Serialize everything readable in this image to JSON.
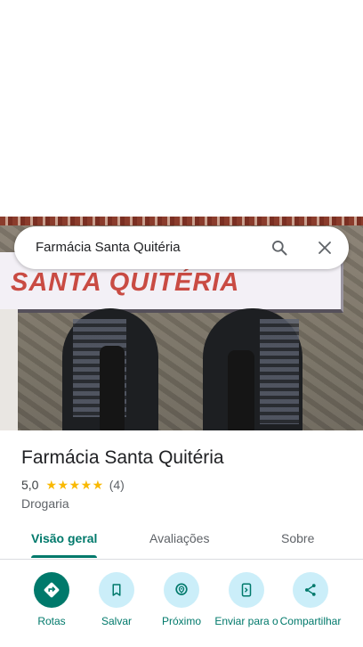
{
  "search": {
    "query": "Farmácia Santa Quitéria",
    "search_icon": "search-icon",
    "close_icon": "close-icon"
  },
  "photo": {
    "sign_text": "SANTA QUITÉRIA"
  },
  "place": {
    "name": "Farmácia Santa Quitéria",
    "rating": "5,0",
    "stars": "★★★★★",
    "review_count": "(4)",
    "category": "Drogaria"
  },
  "tabs": [
    {
      "label": "Visão geral",
      "active": true
    },
    {
      "label": "Avaliações",
      "active": false
    },
    {
      "label": "Sobre",
      "active": false
    }
  ],
  "actions": [
    {
      "label": "Rotas",
      "icon": "directions-icon"
    },
    {
      "label": "Salvar",
      "icon": "bookmark-icon"
    },
    {
      "label": "Próximo",
      "icon": "nearby-icon"
    },
    {
      "label": "Enviar para o",
      "icon": "send-to-phone-icon"
    },
    {
      "label": "Compartilhar",
      "icon": "share-icon"
    }
  ],
  "colors": {
    "accent": "#00796b",
    "action_bg": "#cbeef9",
    "star": "#f9b902"
  }
}
